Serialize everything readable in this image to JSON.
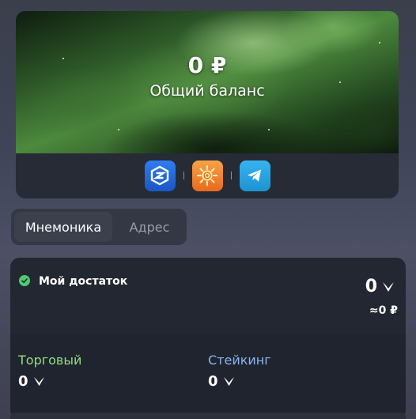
{
  "balance": {
    "amount": "0 ₽",
    "label": "Общий баланс"
  },
  "apps": [
    {
      "name": "blue-s-app-icon",
      "color": "#2f7df0"
    },
    {
      "name": "sun-app-icon",
      "color": "#e86a1e"
    },
    {
      "name": "telegram-icon",
      "color": "#1d93d2"
    }
  ],
  "tabs": [
    {
      "label": "Мнемоника",
      "active": true
    },
    {
      "label": "Адрес",
      "active": false
    }
  ],
  "wealth": {
    "title": "Мой достаток",
    "amount": "0",
    "rub": "≈0 ₽",
    "trading_label": "Торговый",
    "trading_value": "0",
    "staking_label": "Стейкинг",
    "staking_value": "0"
  },
  "colors": {
    "trading": "#8fe07f",
    "staking": "#8ab5f2",
    "check": "#4ecb71"
  }
}
